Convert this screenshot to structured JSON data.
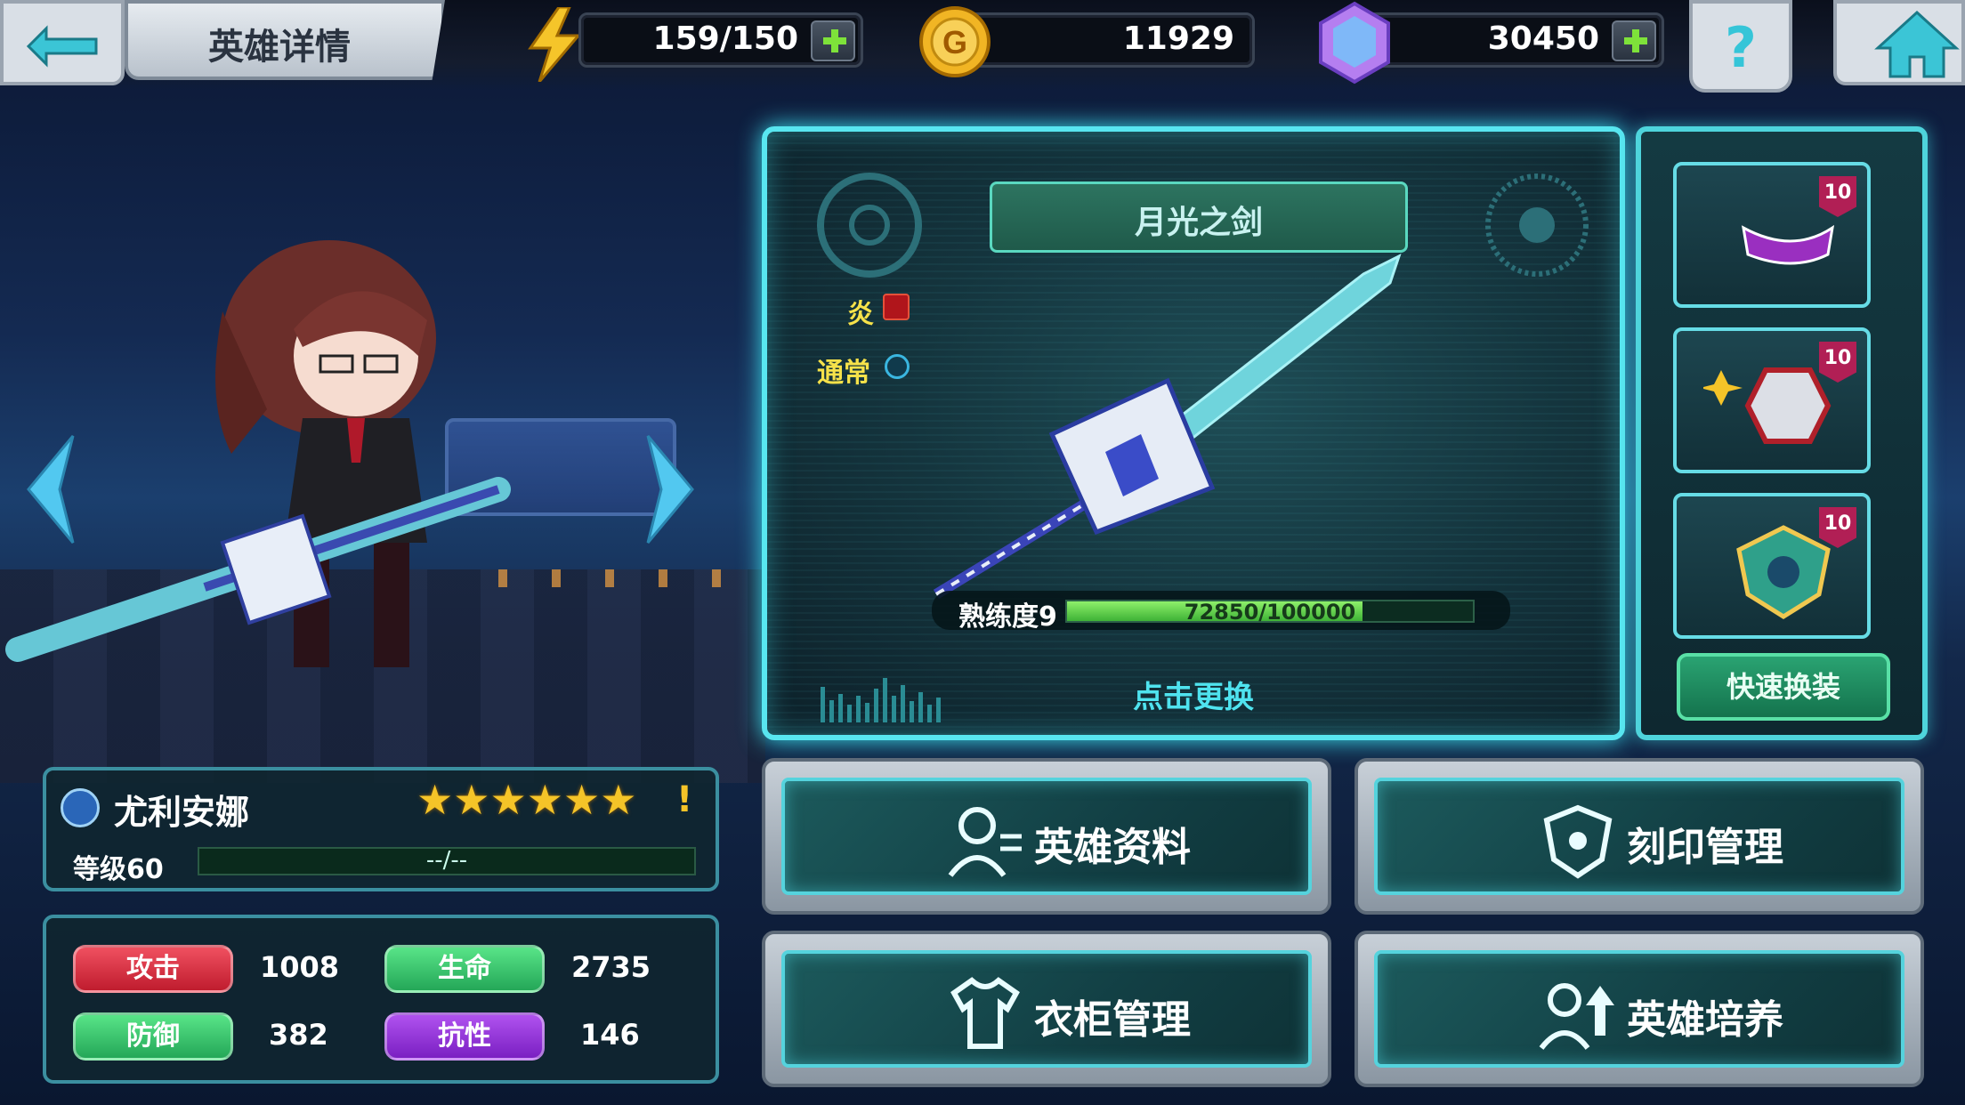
{
  "header": {
    "title": "英雄详情",
    "energy": "159/150",
    "gold": "11929",
    "gems": "30450",
    "help": "?"
  },
  "weapon": {
    "name": "月光之剑",
    "element": "炎",
    "attack_type": "通常",
    "proficiency_label": "熟练度9",
    "proficiency_value": "72850/100000",
    "proficiency_fraction": 0.7285,
    "change_label": "点击更换"
  },
  "equipment": {
    "slots": [
      {
        "level": "10",
        "item": "wing-accessory-icon"
      },
      {
        "level": "10",
        "item": "armor-icon"
      },
      {
        "level": "10",
        "item": "emblem-icon"
      }
    ],
    "quick_change": "快速换装"
  },
  "hero": {
    "name": "尤利安娜",
    "stars": "★★★★★★",
    "alert": "!",
    "level_label": "等级60",
    "level_progress": "--/--"
  },
  "stats": {
    "attack_label": "攻击",
    "attack": "1008",
    "hp_label": "生命",
    "hp": "2735",
    "defense_label": "防御",
    "defense": "382",
    "resist_label": "抗性",
    "resist": "146"
  },
  "menu": {
    "hero_info": "英雄资料",
    "imprint": "刻印管理",
    "wardrobe": "衣柜管理",
    "training": "英雄培养"
  },
  "colors": {
    "accent": "#58e6f0",
    "attack": "#c01c2e",
    "hp": "#24a758",
    "resist": "#7a1fc2"
  }
}
